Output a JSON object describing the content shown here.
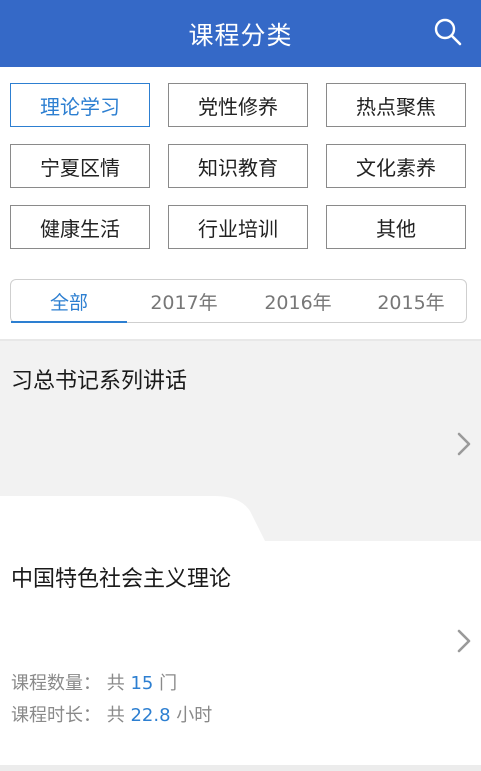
{
  "header": {
    "title": "课程分类"
  },
  "categories": [
    {
      "label": "理论学习",
      "active": true
    },
    {
      "label": "党性修养",
      "active": false
    },
    {
      "label": "热点聚焦",
      "active": false
    },
    {
      "label": "宁夏区情",
      "active": false
    },
    {
      "label": "知识教育",
      "active": false
    },
    {
      "label": "文化素养",
      "active": false
    },
    {
      "label": "健康生活",
      "active": false
    },
    {
      "label": "行业培训",
      "active": false
    },
    {
      "label": "其他",
      "active": false
    }
  ],
  "year_tabs": [
    {
      "label": "全部",
      "active": true
    },
    {
      "label": "2017年",
      "active": false
    },
    {
      "label": "2016年",
      "active": false
    },
    {
      "label": "2015年",
      "active": false
    }
  ],
  "courses": [
    {
      "title": "习总书记系列讲话"
    },
    {
      "title": "中国特色社会主义理论",
      "count_label": "课程数量：",
      "count_prefix": "共",
      "count_value": "15",
      "count_unit": "门",
      "duration_label": "课程时长：",
      "duration_prefix": "共",
      "duration_value": "22.8",
      "duration_unit": "小时"
    }
  ],
  "colors": {
    "header_bg": "#3569c7",
    "accent": "#2d7fd1"
  },
  "icons": {
    "search": "search-icon",
    "chevron": "chevron-right-icon"
  }
}
